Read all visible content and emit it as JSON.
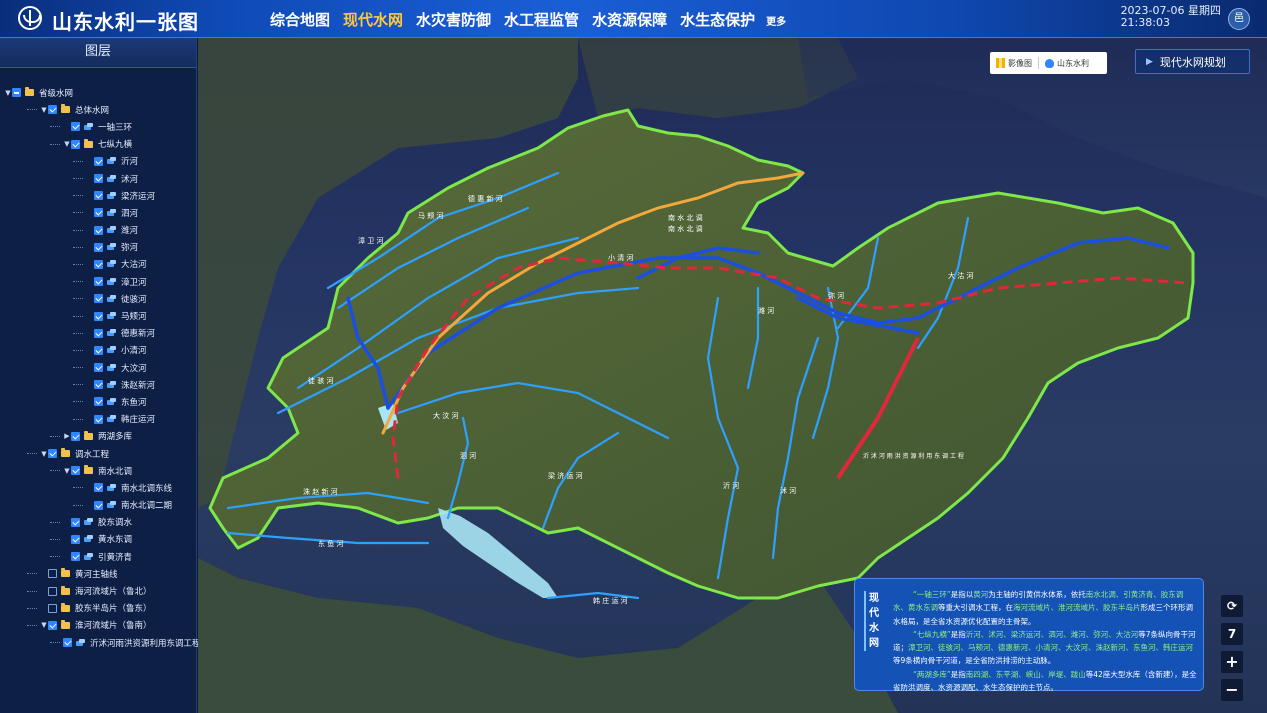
{
  "app": {
    "title": "山东水利一张图",
    "user_avatar": "邑"
  },
  "nav": {
    "items": [
      {
        "label": "综合地图",
        "active": false
      },
      {
        "label": "现代水网",
        "active": true
      },
      {
        "label": "水灾害防御",
        "active": false
      },
      {
        "label": "水工程监管",
        "active": false
      },
      {
        "label": "水资源保障",
        "active": false
      },
      {
        "label": "水生态保护",
        "active": false
      }
    ],
    "more_label": "更多"
  },
  "datetime": {
    "date": "2023-07-06 星期四",
    "time": "21:38:03"
  },
  "sidebar": {
    "title": "图层",
    "tree": [
      {
        "label": "省级水网",
        "level": 0,
        "expand": "▼",
        "check": "part",
        "type": "folder"
      },
      {
        "label": "总体水网",
        "level": 1,
        "expand": "▼",
        "check": "on",
        "type": "folder"
      },
      {
        "label": "一轴三环",
        "level": 2,
        "expand": "",
        "check": "on",
        "type": "layer"
      },
      {
        "label": "七纵九横",
        "level": 2,
        "expand": "▼",
        "check": "on",
        "type": "folder"
      },
      {
        "label": "沂河",
        "level": 3,
        "expand": "",
        "check": "on",
        "type": "layer"
      },
      {
        "label": "沭河",
        "level": 3,
        "expand": "",
        "check": "on",
        "type": "layer"
      },
      {
        "label": "梁济运河",
        "level": 3,
        "expand": "",
        "check": "on",
        "type": "layer"
      },
      {
        "label": "泗河",
        "level": 3,
        "expand": "",
        "check": "on",
        "type": "layer"
      },
      {
        "label": "潍河",
        "level": 3,
        "expand": "",
        "check": "on",
        "type": "layer"
      },
      {
        "label": "弥河",
        "level": 3,
        "expand": "",
        "check": "on",
        "type": "layer"
      },
      {
        "label": "大沽河",
        "level": 3,
        "expand": "",
        "check": "on",
        "type": "layer"
      },
      {
        "label": "漳卫河",
        "level": 3,
        "expand": "",
        "check": "on",
        "type": "layer"
      },
      {
        "label": "徒骇河",
        "level": 3,
        "expand": "",
        "check": "on",
        "type": "layer"
      },
      {
        "label": "马颊河",
        "level": 3,
        "expand": "",
        "check": "on",
        "type": "layer"
      },
      {
        "label": "德惠新河",
        "level": 3,
        "expand": "",
        "check": "on",
        "type": "layer"
      },
      {
        "label": "小清河",
        "level": 3,
        "expand": "",
        "check": "on",
        "type": "layer"
      },
      {
        "label": "大汶河",
        "level": 3,
        "expand": "",
        "check": "on",
        "type": "layer"
      },
      {
        "label": "洙赵新河",
        "level": 3,
        "expand": "",
        "check": "on",
        "type": "layer"
      },
      {
        "label": "东鱼河",
        "level": 3,
        "expand": "",
        "check": "on",
        "type": "layer"
      },
      {
        "label": "韩庄运河",
        "level": 3,
        "expand": "",
        "check": "on",
        "type": "layer"
      },
      {
        "label": "两湖多库",
        "level": 2,
        "expand": "▶",
        "check": "on",
        "type": "folder"
      },
      {
        "label": "调水工程",
        "level": 1,
        "expand": "▼",
        "check": "on",
        "type": "folder"
      },
      {
        "label": "南水北调",
        "level": 2,
        "expand": "▼",
        "check": "on",
        "type": "folder"
      },
      {
        "label": "南水北调东线",
        "level": 3,
        "expand": "",
        "check": "on",
        "type": "layer"
      },
      {
        "label": "南水北调二期",
        "level": 3,
        "expand": "",
        "check": "on",
        "type": "layer"
      },
      {
        "label": "胶东调水",
        "level": 2,
        "expand": "",
        "check": "on",
        "type": "layer"
      },
      {
        "label": "黄水东调",
        "level": 2,
        "expand": "",
        "check": "on",
        "type": "layer"
      },
      {
        "label": "引黄济青",
        "level": 2,
        "expand": "",
        "check": "on",
        "type": "layer"
      },
      {
        "label": "黄河主轴线",
        "level": 1,
        "expand": "",
        "check": "off",
        "type": "folder"
      },
      {
        "label": "海河流域片（鲁北）",
        "level": 1,
        "expand": "",
        "check": "off",
        "type": "folder"
      },
      {
        "label": "胶东半岛片（鲁东）",
        "level": 1,
        "expand": "",
        "check": "off",
        "type": "folder"
      },
      {
        "label": "淮河流域片（鲁南）",
        "level": 1,
        "expand": "▼",
        "check": "on",
        "type": "folder"
      },
      {
        "label": "沂沭河雨洪资源利用东调工程",
        "level": 2,
        "expand": "",
        "check": "on",
        "type": "layer"
      }
    ]
  },
  "map": {
    "basemap": {
      "image_label": "影像图",
      "water_label": "山东水利"
    },
    "plan_button": "现代水网规划",
    "controls": {
      "refresh_icon": "refresh-icon",
      "level": "7",
      "zoom_in": "+",
      "zoom_out": "−"
    },
    "river_labels": [
      "南 水 北 调",
      "南 水 北 调",
      "小 清 河",
      "大 汶 河",
      "洙 赵 新 河",
      "东 鱼 河",
      "泗 河",
      "沂 河",
      "沭 河",
      "潍 河",
      "弥 河",
      "大 沽 河",
      "马 颊 河",
      "徒 骇 河",
      "德 惠 新 河",
      "漳 卫 河",
      "梁 济 运 河",
      "韩 庄 运 河",
      "沂 沭 河 雨 洪 资 源 利 用 东 调 工 程"
    ],
    "colors": {
      "boundary": "#7ee84a",
      "river": "#2ea0ff",
      "main_canal": "#1c4fe0",
      "yellow_axis": "#f2a83a",
      "ring": "#e0283a",
      "lake": "#a9e6f5"
    }
  },
  "info_panel": {
    "side_title": "现代水网",
    "paragraphs": [
      [
        {
          "t": "“一轴三环”",
          "h": true
        },
        {
          "t": "是指以",
          "h": false
        },
        {
          "t": "黄河",
          "h": true
        },
        {
          "t": "为主轴的引黄供水体系，依托",
          "h": false
        },
        {
          "t": "南水北调、引黄济青、胶东调水、黄水东调",
          "h": true
        },
        {
          "t": "等重大引调水工程，在",
          "h": false
        },
        {
          "t": "海河流域片、淮河流域片、胶东半岛片",
          "h": true
        },
        {
          "t": "形成三个环形调水格局，是全省水资源优化配置的主骨架。",
          "h": false
        }
      ],
      [
        {
          "t": "“七纵九横”",
          "h": true
        },
        {
          "t": "是指",
          "h": false
        },
        {
          "t": "沂河、沭河、梁济运河、泗河、潍河、弥河、大沽河",
          "h": true
        },
        {
          "t": "等7条纵向骨干河道；",
          "h": false
        },
        {
          "t": "漳卫河、徒骇河、马颊河、德惠新河、小清河、大汶河、洙赵新河、东鱼河、韩庄运河",
          "h": true
        },
        {
          "t": "等9条横向骨干河道，是全省防洪排涝的主动脉。",
          "h": false
        }
      ],
      [
        {
          "t": "“两湖多库”",
          "h": true
        },
        {
          "t": "是指",
          "h": false
        },
        {
          "t": "南四湖、东平湖、峡山、岸堤、跋山",
          "h": true
        },
        {
          "t": "等42座大型水库（含新建），是全省防洪调度、水资源调配、水生态保护的主节点。",
          "h": false
        }
      ]
    ]
  }
}
